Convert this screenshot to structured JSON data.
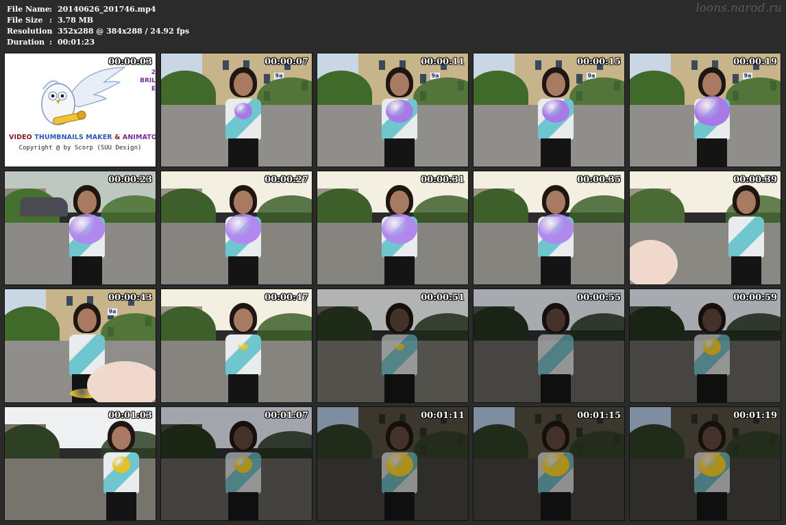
{
  "file_info": {
    "rows": [
      {
        "label": "File Name",
        "value": "20140626_201746.mp4"
      },
      {
        "label": "File Size",
        "value": "3.78 MB"
      },
      {
        "label": "Resolution",
        "value": "352x288 @ 384x288 / 24.92 fps"
      },
      {
        "label": "Duration",
        "value": "00:01:23"
      }
    ],
    "separator": ":"
  },
  "watermark": "loons.narod.ru",
  "logo": {
    "title_part1": "VIDEO ",
    "title_part2": "THUMBNAILS MAKER",
    "title_part3": " & ",
    "title_part4": "ANIMATOR",
    "copyright": "Copyright @ by Scorp (SUU Design)",
    "side_text": [
      "2",
      "BRIL",
      "E"
    ]
  },
  "thumbnails": [
    {
      "timestamp": "00:00:03",
      "scene": "logo"
    },
    {
      "timestamp": "00:00:07",
      "scene": "day-building",
      "balloon_color": "#a87ae6",
      "balloon_size": "small",
      "plate": "9a"
    },
    {
      "timestamp": "00:00:11",
      "scene": "day-building",
      "balloon_color": "#a87ae6",
      "balloon_size": "medium",
      "plate": "9a"
    },
    {
      "timestamp": "00:00:15",
      "scene": "day-building",
      "balloon_color": "#a87ae6",
      "balloon_size": "medium",
      "plate": "9a"
    },
    {
      "timestamp": "00:00:19",
      "scene": "day-building",
      "balloon_color": "#a87ae6",
      "balloon_size": "large",
      "plate": "9a"
    },
    {
      "timestamp": "00:00:23",
      "scene": "parking",
      "balloon_color": "#b088ee",
      "balloon_size": "large"
    },
    {
      "timestamp": "00:00:27",
      "scene": "courtyard",
      "balloon_color": "#b088ee",
      "balloon_size": "large"
    },
    {
      "timestamp": "00:00:31",
      "scene": "courtyard",
      "balloon_color": "#b088ee",
      "balloon_size": "large"
    },
    {
      "timestamp": "00:00:35",
      "scene": "courtyard",
      "balloon_color": "#b088ee",
      "balloon_size": "large"
    },
    {
      "timestamp": "00:00:39",
      "scene": "courtyard-nohand",
      "balloon_color": "",
      "balloon_size": "none"
    },
    {
      "timestamp": "00:00:43",
      "scene": "day-building-hand",
      "balloon_color": "#e8c020",
      "balloon_size": "deflated",
      "plate": "9a"
    },
    {
      "timestamp": "00:00:47",
      "scene": "courtyard",
      "balloon_color": "#e8c020",
      "balloon_size": "tiny"
    },
    {
      "timestamp": "00:00:51",
      "scene": "dusk",
      "balloon_color": "#e8c020",
      "balloon_size": "tiny"
    },
    {
      "timestamp": "00:00:55",
      "scene": "dusk-dark",
      "balloon_color": "",
      "balloon_size": "none"
    },
    {
      "timestamp": "00:00:59",
      "scene": "dusk-dark",
      "balloon_color": "#e8c020",
      "balloon_size": "small"
    },
    {
      "timestamp": "00:01:03",
      "scene": "dusk-side",
      "balloon_color": "#e8c020",
      "balloon_size": "small"
    },
    {
      "timestamp": "00:01:07",
      "scene": "night-street",
      "balloon_color": "#e8c020",
      "balloon_size": "small"
    },
    {
      "timestamp": "00:01:11",
      "scene": "night-building",
      "balloon_color": "#e8c020",
      "balloon_size": "medium"
    },
    {
      "timestamp": "00:01:15",
      "scene": "night-building",
      "balloon_color": "#e8c020",
      "balloon_size": "medium"
    },
    {
      "timestamp": "00:01:19",
      "scene": "night-building",
      "balloon_color": "#e8c020",
      "balloon_size": "medium"
    }
  ]
}
